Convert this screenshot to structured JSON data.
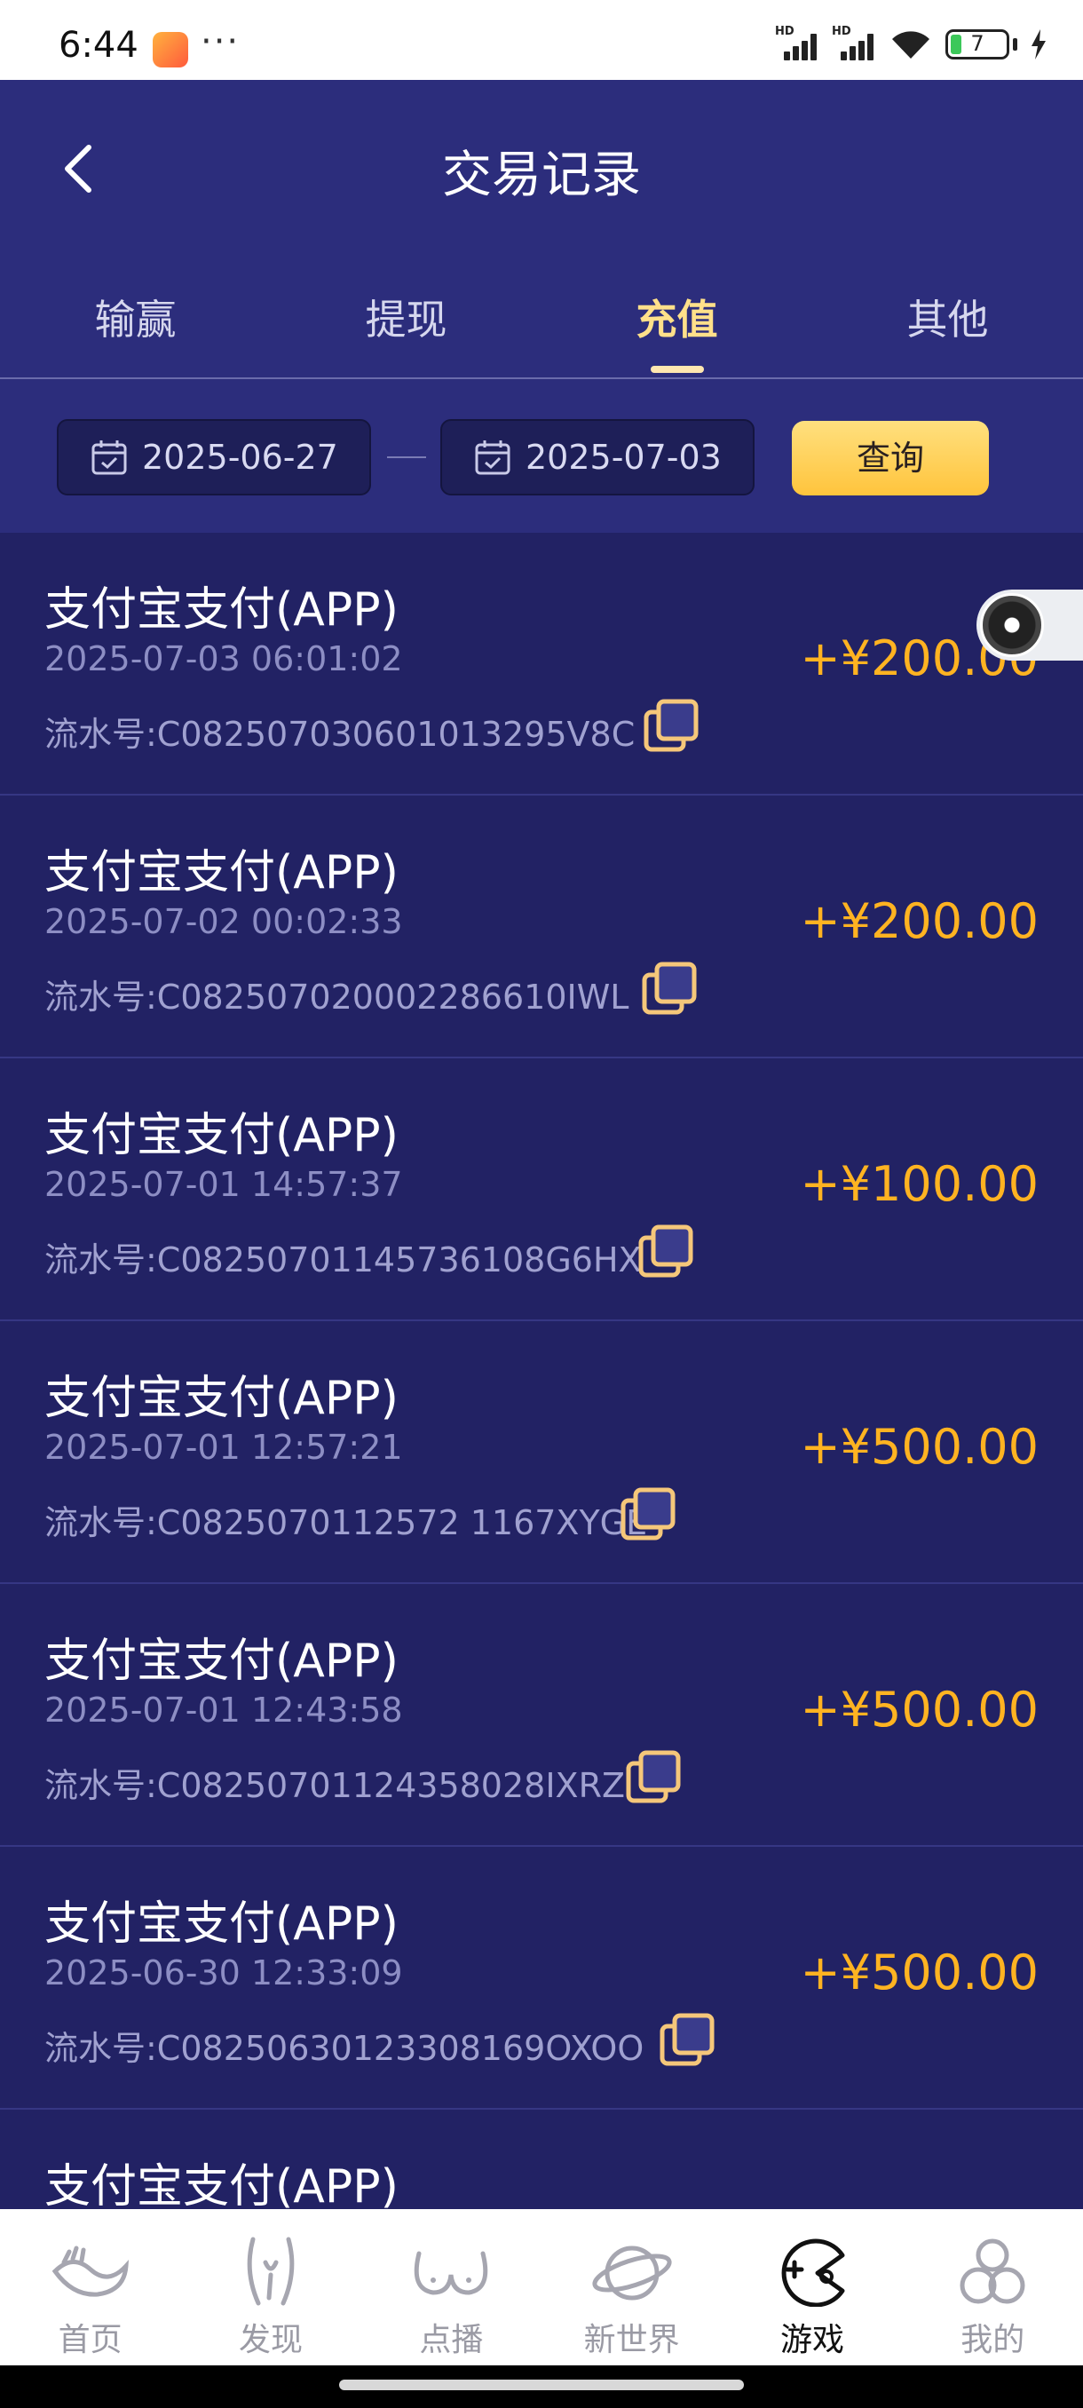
{
  "status_bar": {
    "time": "6:44",
    "dots": "···",
    "battery": "7"
  },
  "header": {
    "title": "交易记录"
  },
  "tabs": [
    {
      "label": "输赢",
      "active": false
    },
    {
      "label": "提现",
      "active": false
    },
    {
      "label": "充值",
      "active": true
    },
    {
      "label": "其他",
      "active": false
    }
  ],
  "filter": {
    "start_date": "2025-06-27",
    "end_date": "2025-07-03",
    "query_label": "查询"
  },
  "transactions": [
    {
      "title": "支付宝支付(APP)",
      "time": "2025-07-03 06:01:02",
      "serial": "流水号:C082507030601013295V8C",
      "amount": "+¥200.00"
    },
    {
      "title": "支付宝支付(APP)",
      "time": "2025-07-02 00:02:33",
      "serial": "流水号:C082507020002286610IWL",
      "amount": "+¥200.00"
    },
    {
      "title": "支付宝支付(APP)",
      "time": "2025-07-01 14:57:37",
      "serial": "流水号:C08250701145736108G6HX",
      "amount": "+¥100.00"
    },
    {
      "title": "支付宝支付(APP)",
      "time": "2025-07-01 12:57:21",
      "serial": "流水号:C0825070112572 1167XYGE",
      "amount": "+¥500.00"
    },
    {
      "title": "支付宝支付(APP)",
      "time": "2025-07-01 12:43:58",
      "serial": "流水号:C08250701124358028IXRZ",
      "amount": "+¥500.00"
    },
    {
      "title": "支付宝支付(APP)",
      "time": "2025-06-30 12:33:09",
      "serial": "流水号:C08250630123308169OXOO",
      "amount": "+¥500.00"
    },
    {
      "title": "支付宝支付(APP)",
      "time": "",
      "serial": "",
      "amount": ""
    }
  ],
  "bottom_nav": [
    {
      "label": "首页",
      "icon": "home-hand-icon",
      "active": false
    },
    {
      "label": "发现",
      "icon": "discover-icon",
      "active": false
    },
    {
      "label": "点播",
      "icon": "vod-icon",
      "active": false
    },
    {
      "label": "新世界",
      "icon": "planet-icon",
      "active": false
    },
    {
      "label": "游戏",
      "icon": "game-icon",
      "active": true
    },
    {
      "label": "我的",
      "icon": "profile-icon",
      "active": false
    }
  ],
  "colors": {
    "header_bg": "#2c2d7c",
    "list_bg": "#222264",
    "accent": "#ffb321",
    "active_tab": "#ffe08a"
  }
}
